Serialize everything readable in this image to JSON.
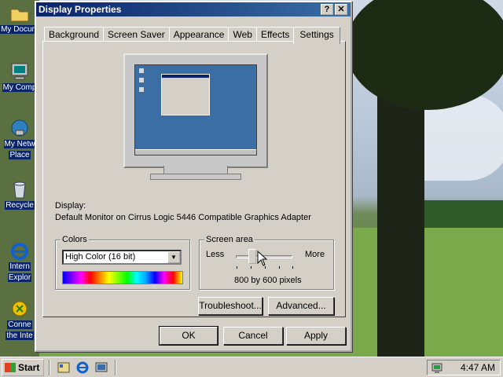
{
  "desktop": {
    "icons": [
      {
        "name": "my-documents",
        "label": "My Docum",
        "icon": "folder-icon"
      },
      {
        "name": "my-computer",
        "label": "My Comp",
        "icon": "computer-icon"
      },
      {
        "name": "my-network-places",
        "label": "My Netw",
        "label2": "Place",
        "icon": "network-icon"
      },
      {
        "name": "recycle-bin",
        "label": "Recycle",
        "icon": "recycle-bin-icon"
      },
      {
        "name": "internet-explorer",
        "label": "Intern",
        "label2": "Explor",
        "icon": "ie-icon"
      },
      {
        "name": "connect-internet",
        "label": "Conne",
        "label2": "the Inte",
        "icon": "connect-icon"
      }
    ]
  },
  "dialog": {
    "title": "Display Properties",
    "help_label": "?",
    "close_label": "✕",
    "tabs": [
      "Background",
      "Screen Saver",
      "Appearance",
      "Web",
      "Effects",
      "Settings"
    ],
    "active_tab": "Settings",
    "display_label": "Display:",
    "display_value": "Default Monitor on Cirrus Logic 5446 Compatible Graphics Adapter",
    "colors": {
      "group_title": "Colors",
      "selected": "High Color (16 bit)"
    },
    "screen_area": {
      "group_title": "Screen area",
      "less_label": "Less",
      "more_label": "More",
      "value_text": "800 by 600 pixels"
    },
    "troubleshoot_label": "Troubleshoot...",
    "advanced_label": "Advanced...",
    "ok_label": "OK",
    "cancel_label": "Cancel",
    "apply_label": "Apply"
  },
  "taskbar": {
    "start_label": "Start",
    "clock": "4:47 AM"
  },
  "colors": {
    "title_active": "#0a246a",
    "desktop": "#3a6ea5",
    "face": "#d4d0c8"
  }
}
